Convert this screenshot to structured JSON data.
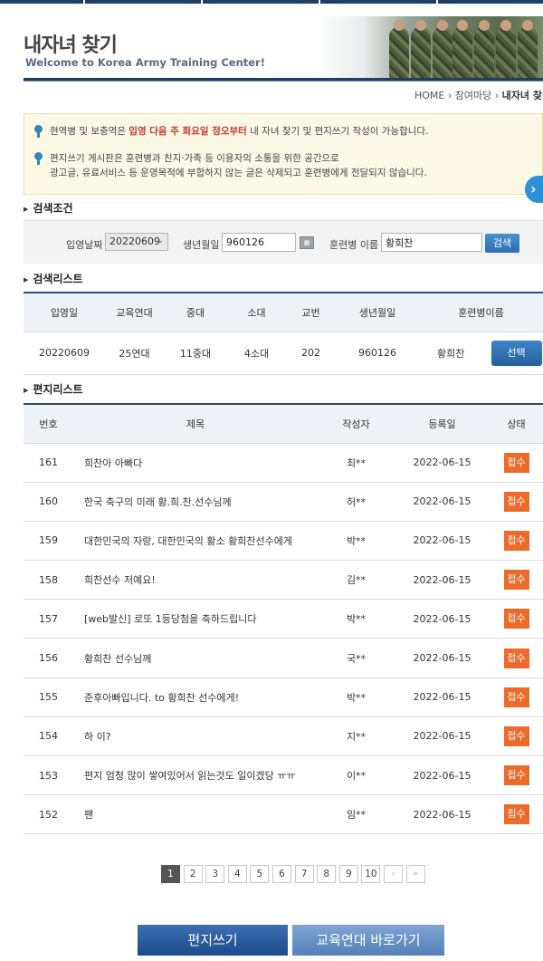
{
  "header": {
    "title": "내자녀 찾기",
    "subtitle": "Welcome to Korea Army Training Center!"
  },
  "breadcrumb": {
    "home": "HOME",
    "parent": "참여마당",
    "current": "내자녀 찾"
  },
  "notice": {
    "line1_pre": "현역병 및 보충역은 ",
    "line1_highlight": "입영 다음 주 화요일 정오부터",
    "line1_post": " 내 자녀 찾기 및 편지쓰기 작성이 가능합니다.",
    "line2a": "편지쓰기 게시판은 훈련병과 친지·가족 등 이용자의 소통을 위한 공간으로",
    "line2b": "광고글, 유료서비스 등 운영목적에 부합하지 않는 글은 삭제되고 훈련병에게 전달되지 않습니다."
  },
  "search": {
    "section_title": "검색조건",
    "enlist_label": "입영날짜",
    "enlist_value": "20220609",
    "birth_label": "생년월일",
    "birth_value": "960126",
    "name_label": "훈련병 이름",
    "name_value": "황희찬",
    "button": "검색"
  },
  "result": {
    "section_title": "검색리스트",
    "headers": [
      "입영일",
      "교육연대",
      "중대",
      "소대",
      "교번",
      "생년월일",
      "훈련병이름"
    ],
    "row": {
      "date": "20220609",
      "regiment": "25연대",
      "company": "11중대",
      "platoon": "4소대",
      "number": "202",
      "birth": "960126",
      "name": "황희찬",
      "button": "선택"
    }
  },
  "letters": {
    "section_title": "편지리스트",
    "headers": {
      "no": "번호",
      "subject": "제목",
      "author": "작성자",
      "date": "등록일",
      "status": "상태"
    },
    "rows": [
      {
        "no": "161",
        "subject": "희찬아 아빠다",
        "author": "최**",
        "date": "2022-06-15",
        "status": "접수"
      },
      {
        "no": "160",
        "subject": "한국 축구의 미래 황.희.찬.선수님께",
        "author": "허**",
        "date": "2022-06-15",
        "status": "접수"
      },
      {
        "no": "159",
        "subject": "대한민국의 자랑, 대한민국의 황소 황희찬선수에게",
        "author": "박**",
        "date": "2022-06-15",
        "status": "접수"
      },
      {
        "no": "158",
        "subject": "희찬선수 저예요!",
        "author": "김**",
        "date": "2022-06-15",
        "status": "접수"
      },
      {
        "no": "157",
        "subject": "[web발신] 로또 1등당첨을 축하드립니다",
        "author": "박**",
        "date": "2022-06-15",
        "status": "접수"
      },
      {
        "no": "156",
        "subject": "황희찬 선수님께",
        "author": "국**",
        "date": "2022-06-15",
        "status": "접수"
      },
      {
        "no": "155",
        "subject": "준후아빠입니다. to 황희찬 선수에게!",
        "author": "박**",
        "date": "2022-06-15",
        "status": "접수"
      },
      {
        "no": "154",
        "subject": "하 이?",
        "author": "지**",
        "date": "2022-06-15",
        "status": "접수"
      },
      {
        "no": "153",
        "subject": "편지 엄청 많이 쌓여있어서 읽는것도 일이겠당 ㅠㅠ",
        "author": "이**",
        "date": "2022-06-15",
        "status": "접수"
      },
      {
        "no": "152",
        "subject": "팬",
        "author": "임**",
        "date": "2022-06-15",
        "status": "접수"
      }
    ]
  },
  "pagination": {
    "pages": [
      "1",
      "2",
      "3",
      "4",
      "5",
      "6",
      "7",
      "8",
      "9",
      "10"
    ],
    "current": "1",
    "next": "›",
    "last": "»"
  },
  "actions": {
    "write": "편지쓰기",
    "goto_regiment": "교육연대 바로가기"
  },
  "colors": {
    "navy": "#1f3d66",
    "badge": "#ec6b2b",
    "button_blue": "#2f6eb1"
  }
}
